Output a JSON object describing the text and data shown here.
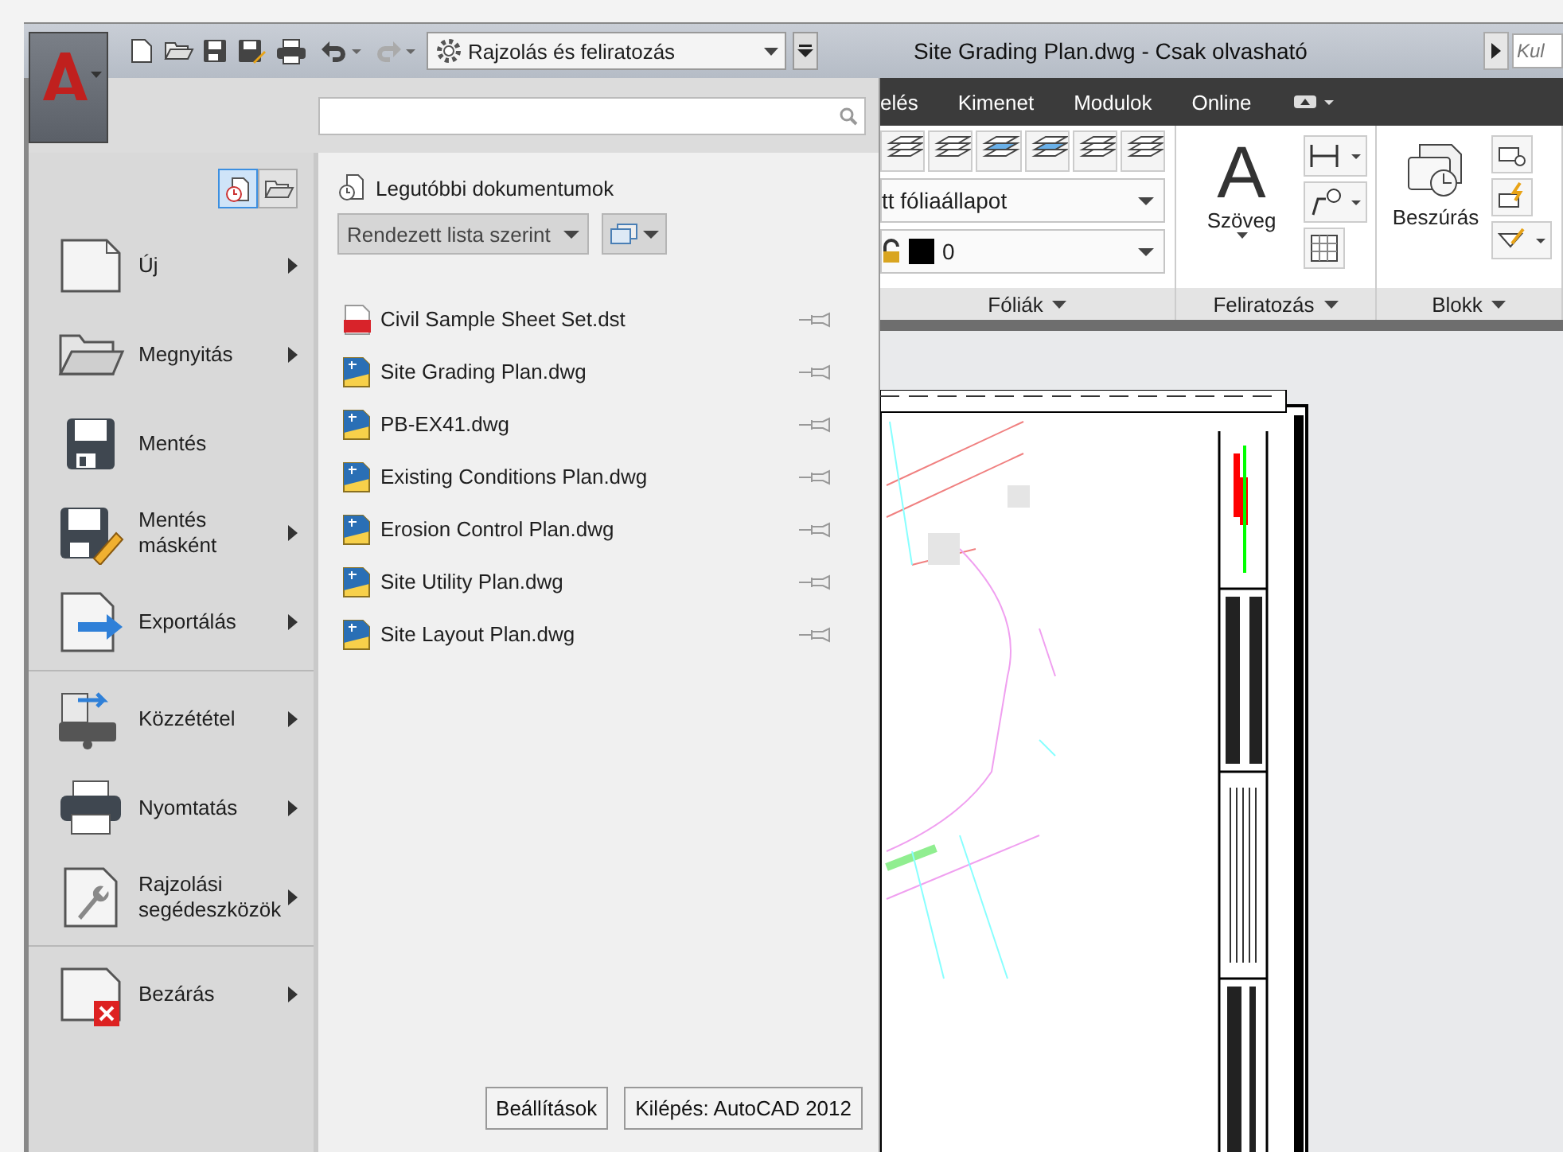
{
  "quick_access": {
    "workspace": "Rajzolás és feliratozás"
  },
  "window": {
    "title": "Site Grading Plan.dwg - Csak olvasható"
  },
  "help_search": {
    "placeholder": "Kul"
  },
  "ribbon_tabs": [
    "elés",
    "Kimenet",
    "Modulok",
    "Online"
  ],
  "ribbon": {
    "layer_state": "tt fóliaállapot",
    "layer": "0",
    "text_icon": "A",
    "text_button": "Szöveg",
    "insert_button": "Beszúrás",
    "panels": [
      "Fóliák",
      "Feliratozás",
      "Blokk"
    ]
  },
  "app_menu": {
    "view_toggle": [
      {
        "kind": "recent",
        "selected": true
      },
      {
        "kind": "open",
        "selected": false
      }
    ],
    "menu_groups": [
      [
        {
          "label": "Új",
          "kind": "new",
          "submenu": true
        },
        {
          "label": "Megnyitás",
          "kind": "open",
          "submenu": true
        },
        {
          "label": "Mentés",
          "kind": "save",
          "submenu": false
        },
        {
          "label": "Mentés másként",
          "kind": "saveas",
          "submenu": true
        },
        {
          "label": "Exportálás",
          "kind": "export",
          "submenu": true
        }
      ],
      [
        {
          "label": "Közzététel",
          "kind": "publish",
          "submenu": true
        },
        {
          "label": "Nyomtatás",
          "kind": "print",
          "submenu": true
        },
        {
          "label": "Rajzolási segédeszközök",
          "kind": "tools",
          "submenu": true
        }
      ],
      [
        {
          "label": "Bezárás",
          "kind": "close",
          "submenu": true
        }
      ]
    ],
    "recent_title": "Legutóbbi dokumentumok",
    "sort": "Rendezett lista szerint",
    "documents": [
      {
        "name": "Civil Sample Sheet Set.dst",
        "kind": "dst",
        "pinned": false
      },
      {
        "name": "Site Grading Plan.dwg",
        "kind": "dwg",
        "pinned": false
      },
      {
        "name": "PB-EX41.dwg",
        "kind": "dwg",
        "pinned": false
      },
      {
        "name": "Existing Conditions Plan.dwg",
        "kind": "dwg",
        "pinned": false
      },
      {
        "name": "Erosion Control Plan.dwg",
        "kind": "dwg",
        "pinned": false
      },
      {
        "name": "Site Utility Plan.dwg",
        "kind": "dwg",
        "pinned": false
      },
      {
        "name": "Site Layout Plan.dwg",
        "kind": "dwg",
        "pinned": false
      }
    ],
    "buttons": [
      "Beállítások",
      "Kilépés: AutoCAD 2012"
    ]
  }
}
